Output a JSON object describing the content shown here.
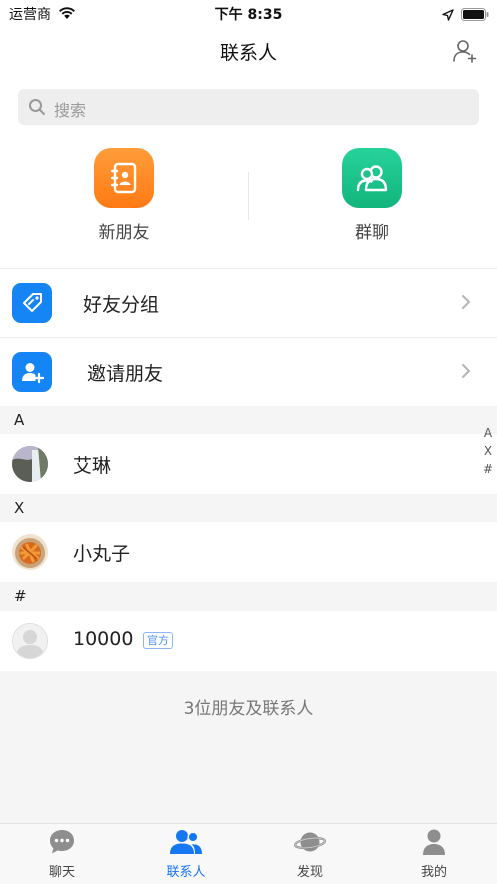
{
  "status": {
    "carrier": "运营商",
    "time": "下午 8:35"
  },
  "nav": {
    "title": "联系人"
  },
  "search": {
    "placeholder": "搜索"
  },
  "quick": [
    {
      "label": "新朋友",
      "icon": "contact-book-icon",
      "color": "#ff8a1f"
    },
    {
      "label": "群聊",
      "icon": "group-icon",
      "color": "#1cc28a"
    }
  ],
  "menu": [
    {
      "label": "好友分组",
      "icon": "tag-icon"
    },
    {
      "label": "邀请朋友",
      "icon": "invite-user-icon"
    }
  ],
  "sections": [
    {
      "letter": "A",
      "contacts": [
        {
          "name": "艾琳"
        }
      ]
    },
    {
      "letter": "X",
      "contacts": [
        {
          "name": "小丸子"
        }
      ]
    },
    {
      "letter": "#",
      "contacts": [
        {
          "name": "10000",
          "badge": "官方"
        }
      ]
    }
  ],
  "index": [
    "A",
    "X",
    "#"
  ],
  "footer": {
    "count_text": "3位朋友及联系人"
  },
  "tabs": [
    {
      "label": "聊天",
      "icon": "chat-icon"
    },
    {
      "label": "联系人",
      "icon": "contacts-icon",
      "active": true
    },
    {
      "label": "发现",
      "icon": "planet-icon"
    },
    {
      "label": "我的",
      "icon": "profile-icon"
    }
  ],
  "colors": {
    "accent": "#1577f2",
    "menu_icon_bg": "#1585f5"
  }
}
